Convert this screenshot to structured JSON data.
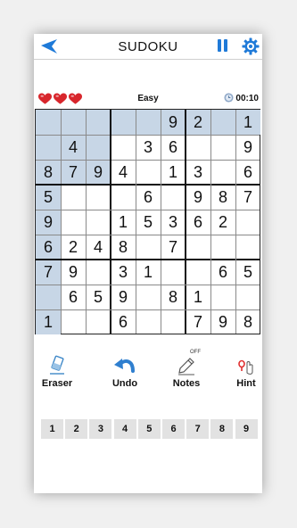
{
  "header": {
    "title": "SUDOKU",
    "back_icon": "back-arrow-icon",
    "pause_icon": "pause-icon",
    "settings_icon": "gear-icon",
    "accent_color": "#1f7ad8"
  },
  "status": {
    "lives": 3,
    "heart_color": "#d8262c",
    "level": "Easy",
    "timer": "00:10"
  },
  "board": {
    "selected_row": 0,
    "selected_col": 0,
    "highlight_color": "#c7d6e6",
    "rows": [
      [
        "",
        "",
        "",
        "",
        "",
        "9",
        "2",
        "",
        "1"
      ],
      [
        "",
        "4",
        "",
        "",
        "3",
        "6",
        "",
        "",
        "9"
      ],
      [
        "8",
        "7",
        "9",
        "4",
        "",
        "1",
        "3",
        "",
        "6"
      ],
      [
        "5",
        "",
        "",
        "",
        "6",
        "",
        "9",
        "8",
        "7"
      ],
      [
        "9",
        "",
        "",
        "1",
        "5",
        "3",
        "6",
        "2",
        ""
      ],
      [
        "6",
        "2",
        "4",
        "8",
        "",
        "7",
        "",
        "",
        ""
      ],
      [
        "7",
        "9",
        "",
        "3",
        "1",
        "",
        "",
        "6",
        "5"
      ],
      [
        "",
        "6",
        "5",
        "9",
        "",
        "8",
        "1",
        "",
        ""
      ],
      [
        "1",
        "",
        "",
        "6",
        "",
        "",
        "7",
        "9",
        "8"
      ]
    ]
  },
  "tools": {
    "eraser": "Eraser",
    "undo": "Undo",
    "notes": "Notes",
    "notes_state": "OFF",
    "hint": "Hint"
  },
  "numpad": [
    "1",
    "2",
    "3",
    "4",
    "5",
    "6",
    "7",
    "8",
    "9"
  ]
}
